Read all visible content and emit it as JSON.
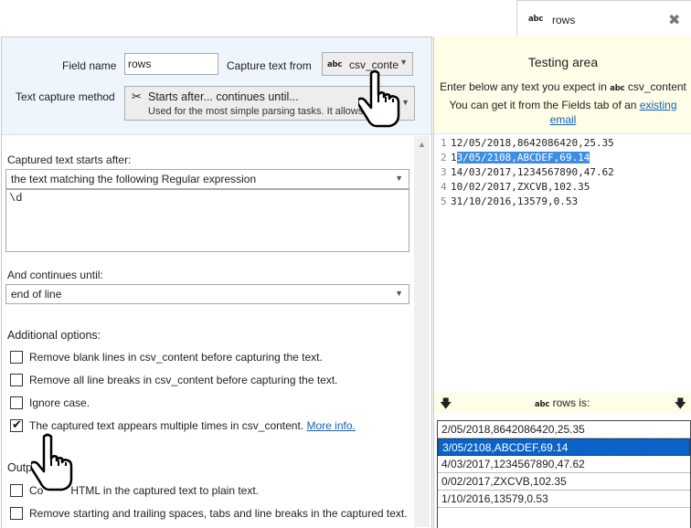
{
  "tab": {
    "icon": "abc",
    "label": "rows",
    "close_glyph": "✖"
  },
  "field": {
    "name_label": "Field name",
    "name_value": "rows",
    "capture_from_label": "Capture text from",
    "capture_from_icon": "abc",
    "capture_from_value": "csv_conte",
    "method_label": "Text capture method",
    "method_title": "Starts after... continues until...",
    "method_desc": "Used for the most simple parsing tasks. It allows"
  },
  "starts_after": {
    "label": "Captured text starts after:",
    "mode": "the text matching the following Regular expression",
    "regex": "\\d"
  },
  "continues_until": {
    "label": "And continues until:",
    "mode": "end of line"
  },
  "options": {
    "label": "Additional options:",
    "items": [
      {
        "text": "Remove blank lines in csv_content before capturing the text.",
        "checked": false
      },
      {
        "text": "Remove all line breaks in csv_content before capturing the text.",
        "checked": false
      },
      {
        "text": "Ignore case.",
        "checked": false
      },
      {
        "text": "The captured text appears multiple times in csv_content.",
        "checked": true,
        "link": "More info."
      }
    ]
  },
  "output": {
    "label": "Outp    tting:",
    "items": [
      {
        "text": "Co         HTML in the captured text to plain text.",
        "checked": false
      },
      {
        "text": "Remove starting and trailing spaces, tabs and line breaks in the captured text.",
        "checked": false
      }
    ]
  },
  "testing": {
    "title": "Testing area",
    "hint_prefix": "Enter below any text you expect in",
    "hint_field_icon": "abc",
    "hint_field": "csv_content",
    "hint2_prefix": "You can get it from the Fields tab of an",
    "hint2_link1": "existing",
    "hint2_link2": "email",
    "lines": [
      {
        "num": "1",
        "pre": "12/05/2018,8642086420,25.35",
        "hl": "",
        "post": ""
      },
      {
        "num": "2",
        "pre": "1",
        "hl": "3/05/2108,ABCDEF,69.14",
        "post": ""
      },
      {
        "num": "3",
        "pre": "14/03/2017,1234567890,47.62",
        "hl": "",
        "post": ""
      },
      {
        "num": "4",
        "pre": "10/02/2017,ZXCVB,102.35",
        "hl": "",
        "post": ""
      },
      {
        "num": "5",
        "pre": "31/10/2016,13579,0.53",
        "hl": "",
        "post": ""
      }
    ]
  },
  "result": {
    "icon": "abc",
    "label": "rows is:",
    "rows": [
      "2/05/2018,8642086420,25.35",
      "3/05/2108,ABCDEF,69.14",
      "4/03/2017,1234567890,47.62",
      "0/02/2017,ZXCVB,102.35",
      "1/10/2016,13579,0.53"
    ],
    "selected_index": 1
  },
  "colors": {
    "header_bg": "#eef5fc",
    "testing_bg": "#fdfde8",
    "selection": "#0a64c8",
    "highlight": "#3d8ee0",
    "link": "#1a5fb4"
  }
}
